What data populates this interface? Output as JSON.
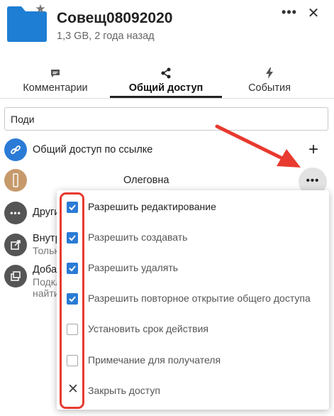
{
  "header": {
    "title": "Совещ08092020",
    "subtitle": "1,3 GB, 2 года назад",
    "more_label": "•••",
    "close_label": "✕"
  },
  "tabs": [
    {
      "label": "Комментарии",
      "icon": "comment-icon"
    },
    {
      "label": "Общий доступ",
      "icon": "share-icon",
      "active": true
    },
    {
      "label": "События",
      "icon": "bolt-icon"
    }
  ],
  "search": {
    "value": "Поди"
  },
  "share": {
    "link_label": "Общий доступ по ссылке",
    "add_label": "+",
    "user_name": "Олеговна",
    "user_more_label": "•••",
    "other_label": "Други",
    "internal_label": "Внутр",
    "internal_sub": "Тольк",
    "add_label_row": "Добав",
    "add_sub_1": "Подкл",
    "add_sub_2": "найти"
  },
  "menu": {
    "items": [
      {
        "label": "Разрешить редактирование",
        "checked": true
      },
      {
        "label": "Разрешить создавать",
        "checked": true
      },
      {
        "label": "Разрешить удалять",
        "checked": true
      },
      {
        "label": "Разрешить повторное открытие общего доступа",
        "checked": true
      },
      {
        "label": "Установить срок действия",
        "checked": false
      },
      {
        "label": "Примечание для получателя",
        "checked": false
      }
    ],
    "close_label": "Закрыть доступ"
  },
  "colors": {
    "folder": "#1d7ed4",
    "accent": "#2b7bd6",
    "avatar": "#c79a6c",
    "annotation_red": "#e83a2f"
  }
}
